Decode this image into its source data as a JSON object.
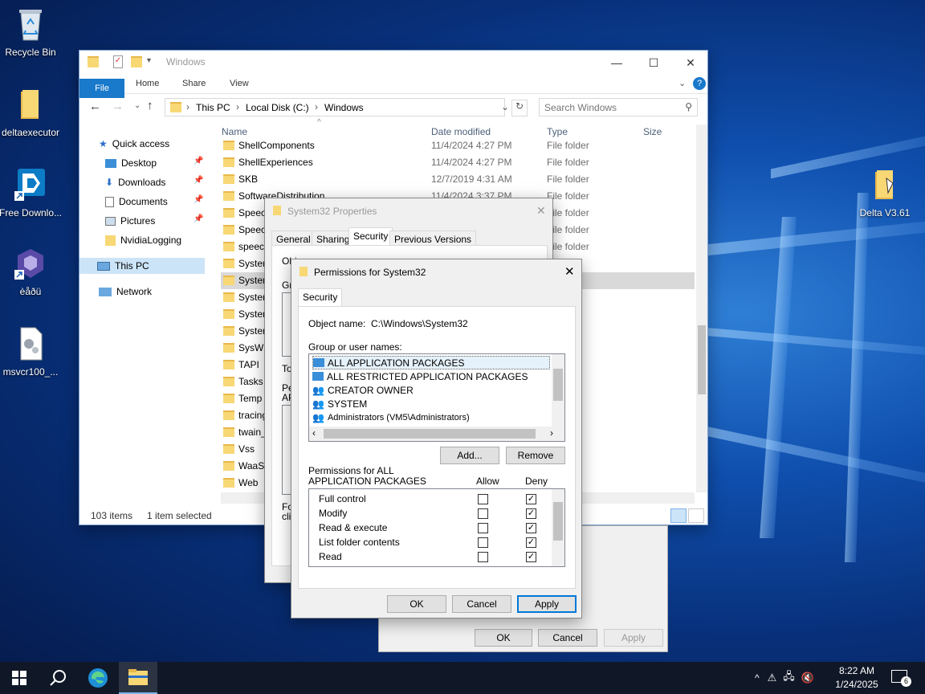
{
  "desktop": {
    "icons": [
      {
        "label": "Recycle Bin"
      },
      {
        "label": "deltaexecutor"
      },
      {
        "label": "Free Downlo..."
      },
      {
        "label": "èåðü"
      },
      {
        "label": "msvcr100_..."
      },
      {
        "label": "Delta V3.61"
      }
    ]
  },
  "explorer": {
    "title": "Windows",
    "ribbon_tabs": [
      "File",
      "Home",
      "Share",
      "View"
    ],
    "breadcrumb": [
      "This PC",
      "Local Disk (C:)",
      "Windows"
    ],
    "search_placeholder": "Search Windows",
    "columns": {
      "name": "Name",
      "date": "Date modified",
      "type": "Type",
      "size": "Size"
    },
    "nav": [
      {
        "label": "Quick access"
      },
      {
        "label": "Desktop"
      },
      {
        "label": "Downloads"
      },
      {
        "label": "Documents"
      },
      {
        "label": "Pictures"
      },
      {
        "label": "NvidiaLogging"
      },
      {
        "label": "This PC"
      },
      {
        "label": "Network"
      }
    ],
    "rows": [
      {
        "name": "ShellComponents",
        "date": "11/4/2024 4:27 PM",
        "type": "File folder"
      },
      {
        "name": "ShellExperiences",
        "date": "11/4/2024 4:27 PM",
        "type": "File folder"
      },
      {
        "name": "SKB",
        "date": "12/7/2019 4:31 AM",
        "type": "File folder"
      },
      {
        "name": "SoftwareDistribution",
        "date": "11/4/2024 3:37 PM",
        "type": "File folder"
      },
      {
        "name": "Speec",
        "date": "",
        "type": "File folder"
      },
      {
        "name": "Speec",
        "date": "",
        "type": "File folder"
      },
      {
        "name": "speech",
        "date": "",
        "type": "File folder"
      },
      {
        "name": "System",
        "date": "",
        "type": "er"
      },
      {
        "name": "System",
        "date": "",
        "type": "er"
      },
      {
        "name": "System",
        "date": "",
        "type": "er"
      },
      {
        "name": "System",
        "date": "",
        "type": "er"
      },
      {
        "name": "System",
        "date": "",
        "type": "er"
      },
      {
        "name": "SysWO",
        "date": "",
        "type": "er"
      },
      {
        "name": "TAPI",
        "date": "",
        "type": "er"
      },
      {
        "name": "Tasks",
        "date": "",
        "type": "er"
      },
      {
        "name": "Temp",
        "date": "",
        "type": "er"
      },
      {
        "name": "tracing",
        "date": "",
        "type": "er"
      },
      {
        "name": "twain_",
        "date": "",
        "type": "er"
      },
      {
        "name": "Vss",
        "date": "",
        "type": "er"
      },
      {
        "name": "WaaS",
        "date": "",
        "type": "er"
      },
      {
        "name": "Web",
        "date": "",
        "type": "er"
      }
    ],
    "status_items": "103 items",
    "status_selected": "1 item selected"
  },
  "properties": {
    "title": "System32 Properties",
    "tabs": [
      "General",
      "Sharing",
      "Security",
      "Previous Versions"
    ],
    "partial": {
      "obj": "Obj",
      "gro": "Gro",
      "to": "To",
      "pe": "Pe",
      "ap": "AP",
      "fo": "Fo",
      "cli": "clic"
    },
    "ok": "OK",
    "cancel": "Cancel",
    "apply": "Apply"
  },
  "permissions": {
    "title": "Permissions for System32",
    "tab": "Security",
    "object_label": "Object name:",
    "object_value": "C:\\Windows\\System32",
    "group_label": "Group or user names:",
    "groups": [
      "ALL APPLICATION PACKAGES",
      "ALL RESTRICTED APPLICATION PACKAGES",
      "CREATOR OWNER",
      "SYSTEM",
      "Administrators (VM5\\Administrators)"
    ],
    "add": "Add...",
    "remove": "Remove",
    "perm_label_1": "Permissions for ALL",
    "perm_label_2": "APPLICATION PACKAGES",
    "allow": "Allow",
    "deny": "Deny",
    "perms": [
      {
        "name": "Full control",
        "allow": false,
        "deny": true
      },
      {
        "name": "Modify",
        "allow": false,
        "deny": true
      },
      {
        "name": "Read & execute",
        "allow": false,
        "deny": true
      },
      {
        "name": "List folder contents",
        "allow": false,
        "deny": true
      },
      {
        "name": "Read",
        "allow": false,
        "deny": true
      }
    ],
    "ok": "OK",
    "cancel": "Cancel",
    "apply": "Apply"
  },
  "taskbar": {
    "time": "8:22 AM",
    "date": "1/24/2025",
    "notif_count": "6"
  }
}
